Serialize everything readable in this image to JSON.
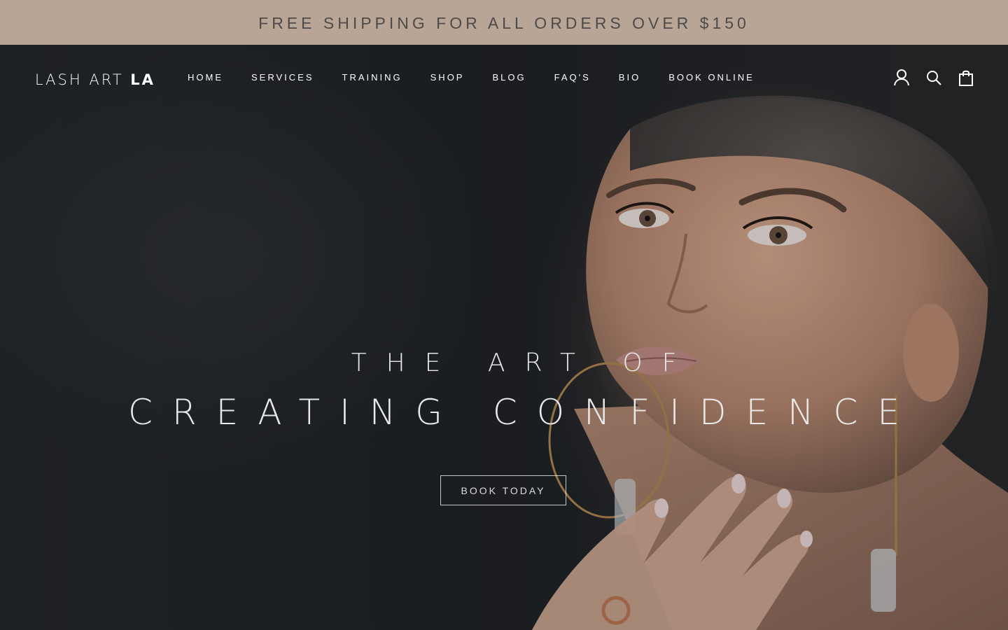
{
  "announcement": {
    "text": "FREE SHIPPING FOR ALL ORDERS OVER $150"
  },
  "header": {
    "logo_light": "LASH ART ",
    "logo_bold": "LA",
    "nav": [
      "HOME",
      "SERVICES",
      "TRAINING",
      "SHOP",
      "BLOG",
      "FAQ'S",
      "BIO",
      "BOOK ONLINE"
    ],
    "icons": [
      "account-icon",
      "search-icon",
      "cart-icon"
    ]
  },
  "hero": {
    "subhead": "THE ART OF",
    "headline": "CREATING CONFIDENCE",
    "cta_label": "BOOK TODAY"
  },
  "colors": {
    "announcement_bg": "#b9a596",
    "announcement_text": "#4e4a49",
    "hero_bg": "#212428",
    "text_light": "#ffffff"
  }
}
